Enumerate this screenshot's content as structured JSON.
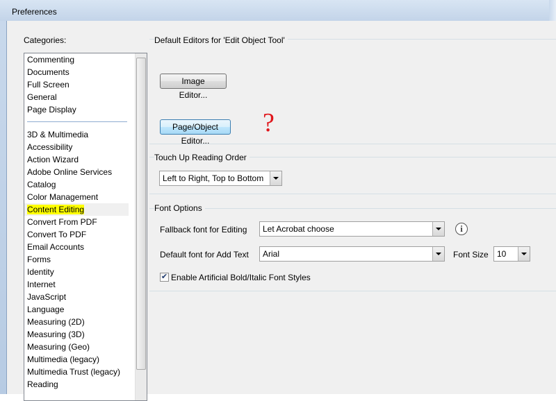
{
  "window": {
    "title": "Preferences"
  },
  "categories": {
    "label": "Categories:",
    "group1": [
      "Commenting",
      "Documents",
      "Full Screen",
      "General",
      "Page Display"
    ],
    "group2": [
      "3D & Multimedia",
      "Accessibility",
      "Action Wizard",
      "Adobe Online Services",
      "Catalog",
      "Color Management",
      "Content Editing",
      "Convert From PDF",
      "Convert To PDF",
      "Email Accounts",
      "Forms",
      "Identity",
      "Internet",
      "JavaScript",
      "Language",
      "Measuring (2D)",
      "Measuring (3D)",
      "Measuring (Geo)",
      "Multimedia (legacy)",
      "Multimedia Trust (legacy)",
      "Reading"
    ],
    "selected": "Content Editing",
    "highlight_color": "#ffff00"
  },
  "editors": {
    "title": "Default Editors for 'Edit Object Tool'",
    "image_editor_label": "Image Editor...",
    "page_object_editor_label": "Page/Object Editor...",
    "annotation_mark": "?",
    "annotation_color": "#e0161c"
  },
  "reading_order": {
    "title": "Touch Up Reading Order",
    "selected_value": "Left to Right, Top to Bottom"
  },
  "font_options": {
    "title": "Font Options",
    "fallback_label": "Fallback font for Editing",
    "fallback_value": "Let Acrobat choose",
    "default_label": "Default font for Add Text",
    "default_value": "Arial",
    "font_size_label": "Font Size",
    "font_size_value": "10",
    "bold_italic_label": "Enable Artificial Bold/Italic Font Styles",
    "bold_italic_checked": true,
    "check_mark": "✔"
  }
}
